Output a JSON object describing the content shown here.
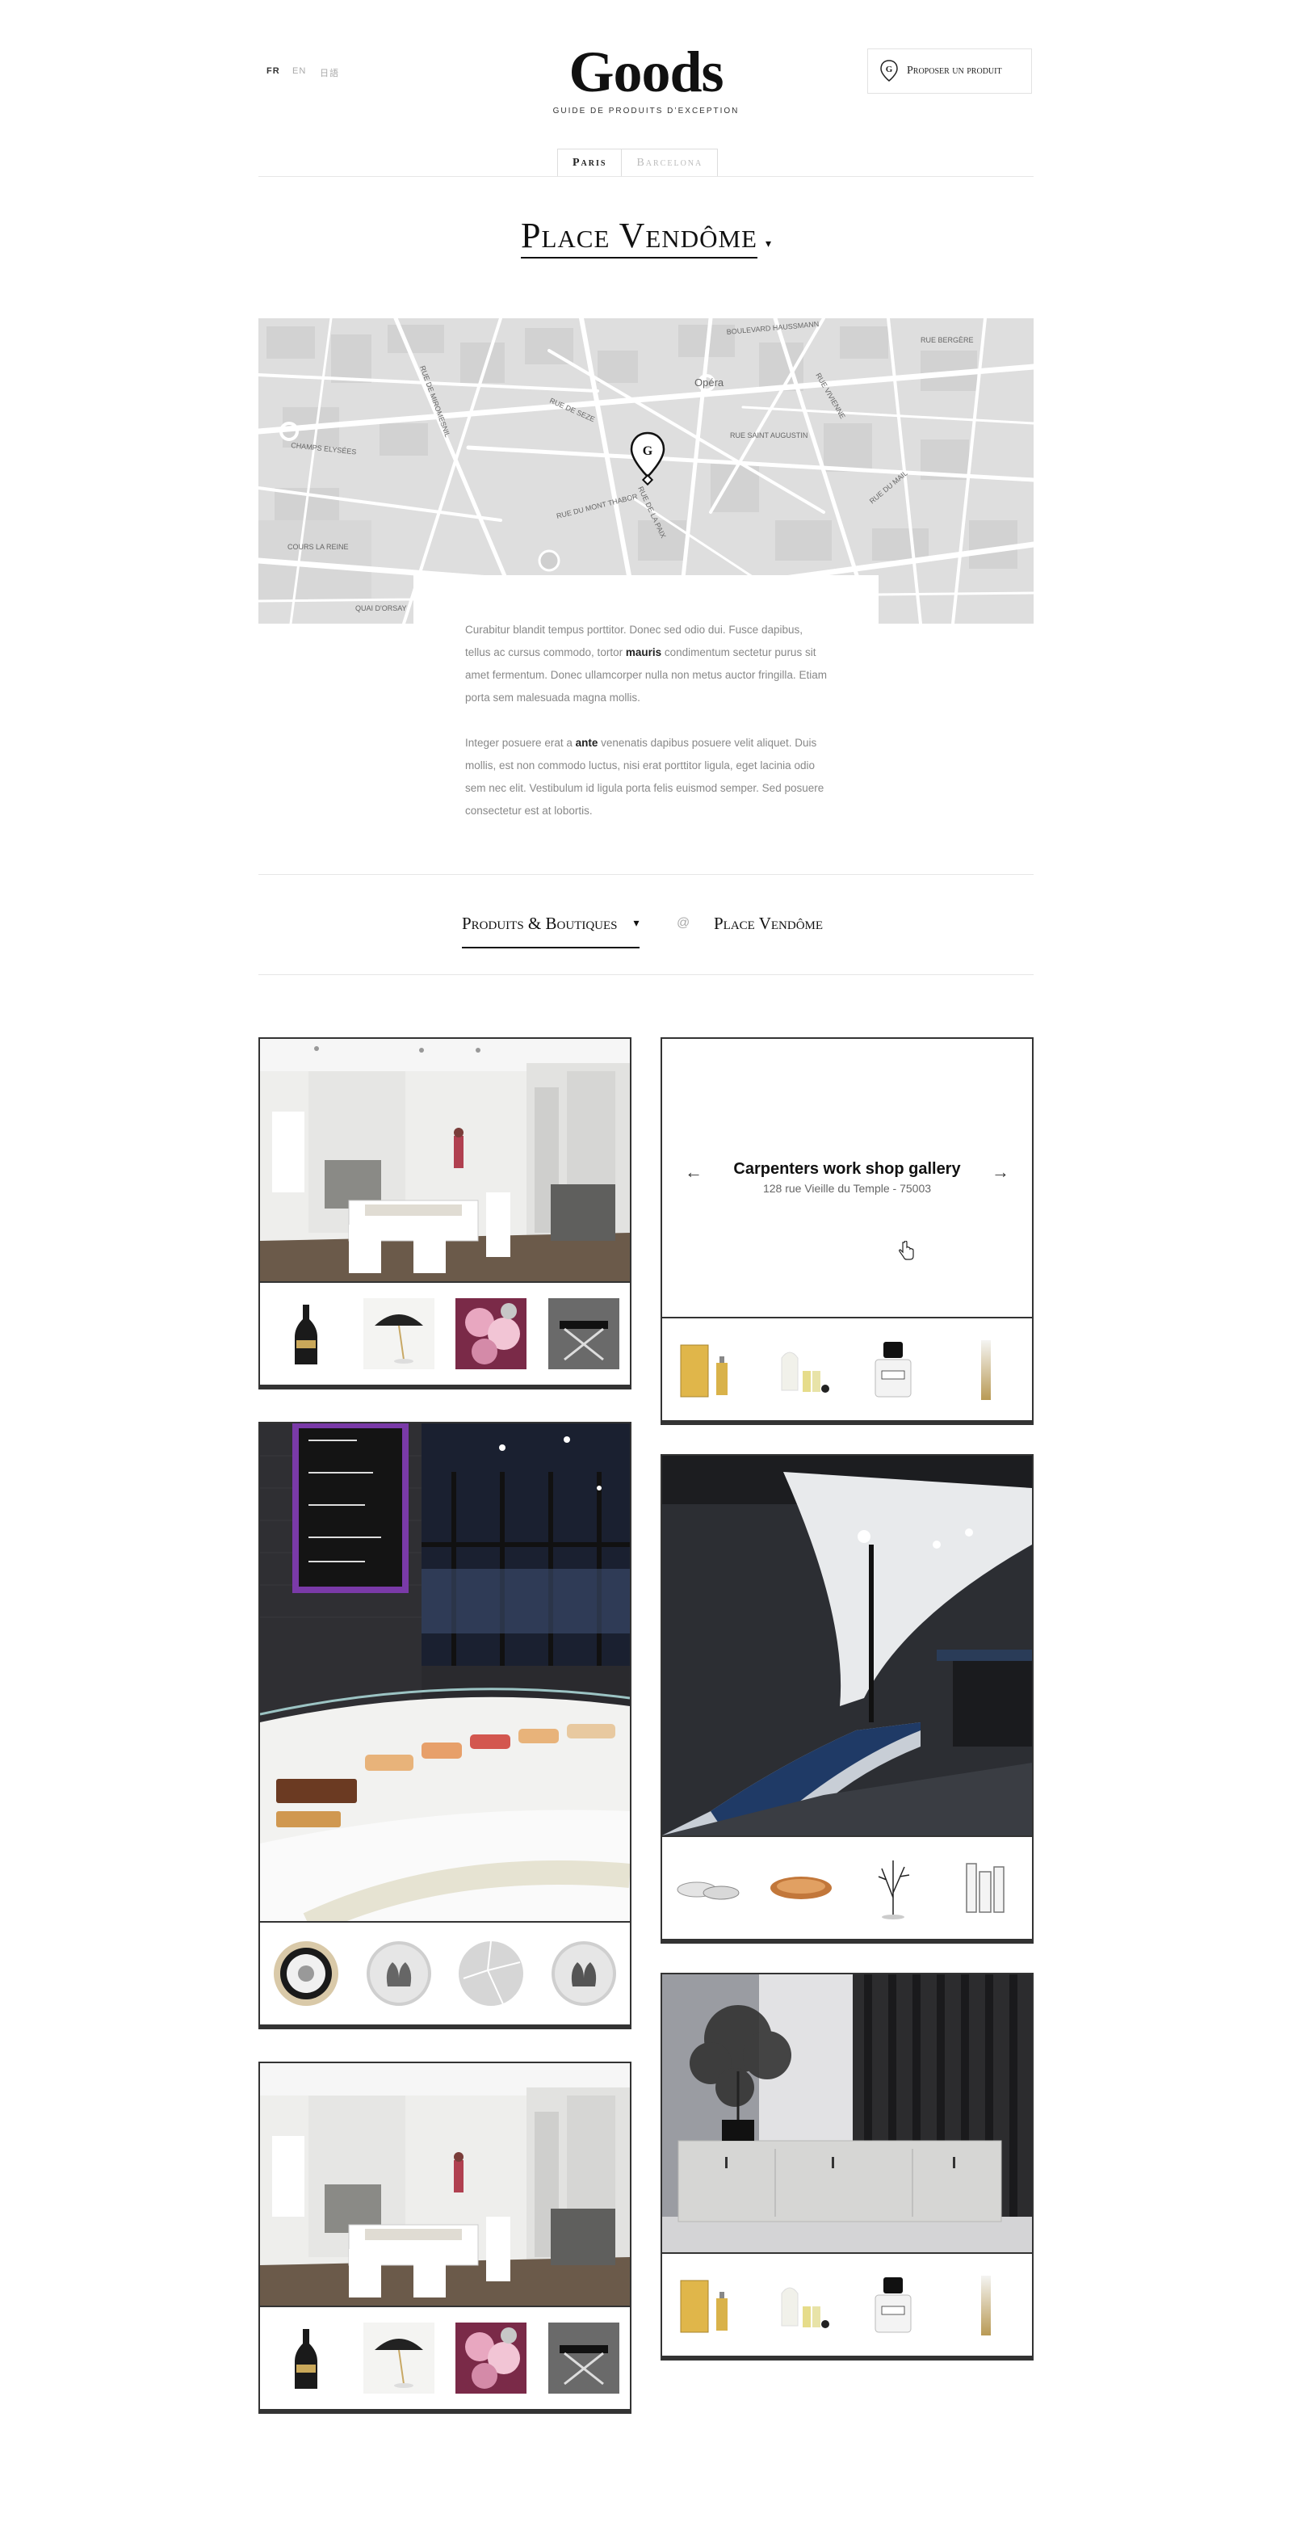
{
  "header": {
    "languages": [
      {
        "code": "FR",
        "active": true
      },
      {
        "code": "EN",
        "active": false
      },
      {
        "code": "日語",
        "active": false
      }
    ],
    "logo": "Goods",
    "tagline": "GUIDE DE PRODUITS D’EXCEPTION",
    "propose_button": "Proposer un produit"
  },
  "city_tabs": [
    {
      "label": "Paris",
      "active": true
    },
    {
      "label": "Barcelona",
      "active": false
    }
  ],
  "place_title": "Place Vendôme",
  "map": {
    "street_labels": [
      "Opéra",
      "RUE SAINT AUGUSTIN",
      "RUE DE SEZE",
      "CHAMPS ELYSÉES",
      "COURS LA REINE",
      "RUE DU MONT THABOR",
      "BOULEVARD HAUSSMANN",
      "RUE BERGÈRE",
      "QUAI D'ORSAY",
      "RUE DE MIROMESNIL",
      "RUE DE LA PAIX",
      "RUE VIVIENNE",
      "RUE DU MAIL"
    ]
  },
  "description": {
    "p1_before": "Curabitur blandit tempus porttitor. Donec sed odio dui. Fusce dapibus, tellus ac cursus commodo, tortor ",
    "p1_bold": "mauris",
    "p1_after": " condimentum sectetur purus sit amet fermentum. Donec ullamcorper nulla non metus auctor fringilla. Etiam porta sem malesuada magna mollis.",
    "p2_before": "Integer posuere erat a ",
    "p2_bold": "ante",
    "p2_after": " venenatis dapibus posuere velit aliquet. Duis mollis, est non commodo luctus, nisi erat porttitor ligula, eget lacinia odio sem nec elit. Vestibulum id ligula porta felis euismod semper. Sed posuere consectetur est at lobortis."
  },
  "filter": {
    "category": "Produits & Boutiques",
    "at_symbol": "@",
    "place": "Place Vendôme"
  },
  "cards": {
    "shop_card": {
      "title": "Carpenters work shop gallery",
      "address": "128 rue Vieille du Temple - 75003",
      "prev": "←",
      "next": "→"
    }
  },
  "colors": {
    "border": "#333333",
    "map_bg": "#e3e3e3",
    "text_muted": "#888888"
  },
  "icons": [
    "location-pin-icon",
    "chevron-down-icon",
    "arrow-left-icon",
    "arrow-right-icon",
    "hand-cursor-icon"
  ]
}
